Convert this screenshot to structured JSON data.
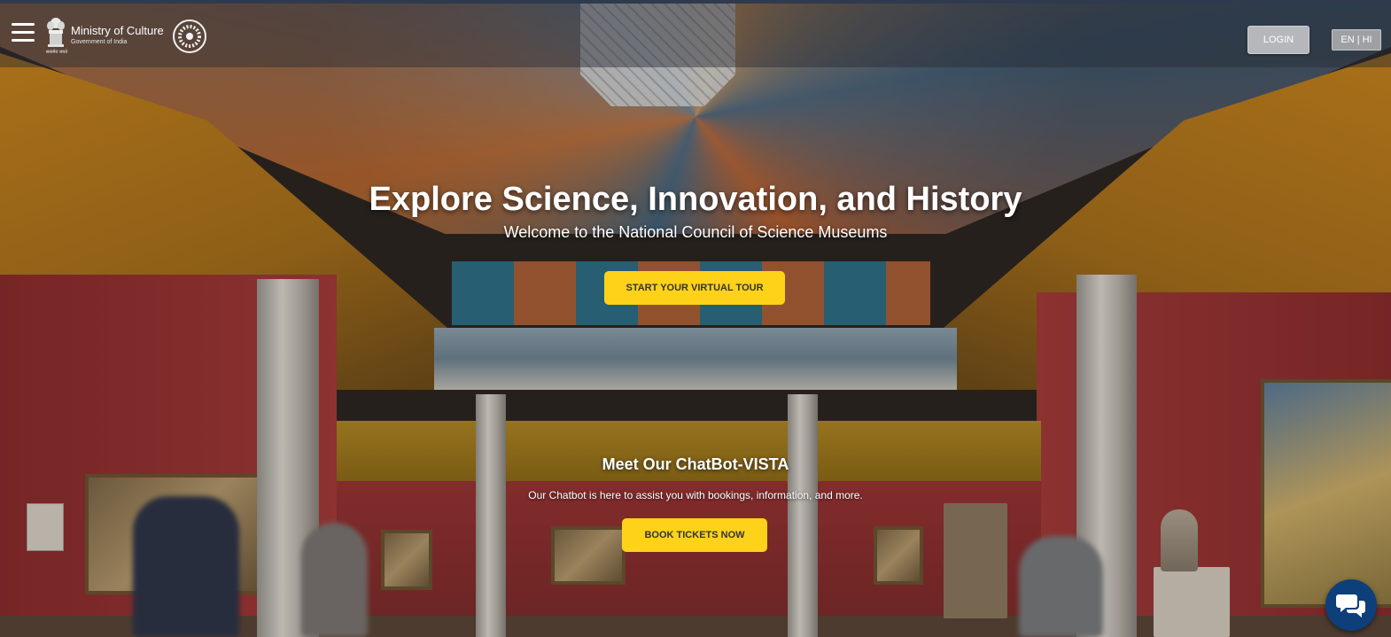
{
  "header": {
    "ministry_title": "Ministry of Culture",
    "ministry_subtitle": "Government of India",
    "emblem_caption": "सत्यमेव जयते",
    "login_label": "LOGIN",
    "language_label": "EN | HI"
  },
  "hero": {
    "title": "Explore Science, Innovation, and History",
    "subtitle": "Welcome to the National Council of Science Museums",
    "cta_label": "START YOUR VIRTUAL TOUR"
  },
  "chatbot": {
    "title": "Meet Our ChatBot-VISTA",
    "description": "Our Chatbot is here to assist you with bookings, information, and more.",
    "cta_label": "BOOK TICKETS NOW"
  },
  "icons": {
    "menu": "hamburger-menu-icon",
    "emblem": "state-emblem-icon",
    "wheel": "chakra-wheel-icon",
    "chat": "chat-bubbles-icon"
  },
  "colors": {
    "accent": "#ffd21a",
    "chat_fab": "#0d3f7a"
  }
}
